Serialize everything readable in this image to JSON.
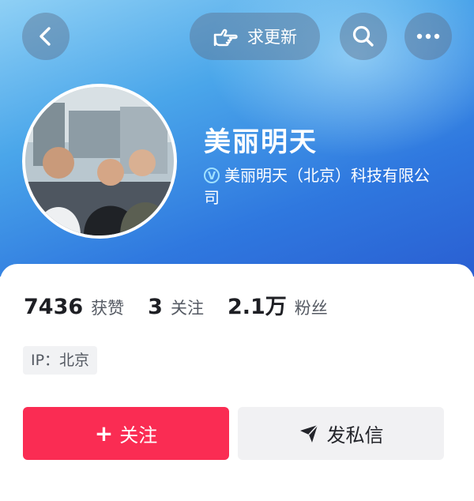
{
  "topbar": {
    "back_icon": "chevron-left-icon",
    "request_update_label": "求更新",
    "request_update_icon": "pointing-hand-icon",
    "search_icon": "search-icon",
    "more_icon": "more-dots-icon"
  },
  "profile": {
    "name": "美丽明天",
    "verification_badge": "V",
    "verification_text": "美丽明天（北京）科技有限公司"
  },
  "stats": [
    {
      "value": "7436",
      "label": "获赞"
    },
    {
      "value": "3",
      "label": "关注"
    },
    {
      "value": "2.1万",
      "label": "粉丝"
    }
  ],
  "ip_tag": "IP：北京",
  "actions": {
    "follow_label": "关注",
    "follow_prefix": "+",
    "message_label": "发私信",
    "message_icon": "send-icon"
  },
  "colors": {
    "header_blue": "#2f78df",
    "follow_red": "#fa2c53",
    "message_gray": "#f1f1f3"
  }
}
